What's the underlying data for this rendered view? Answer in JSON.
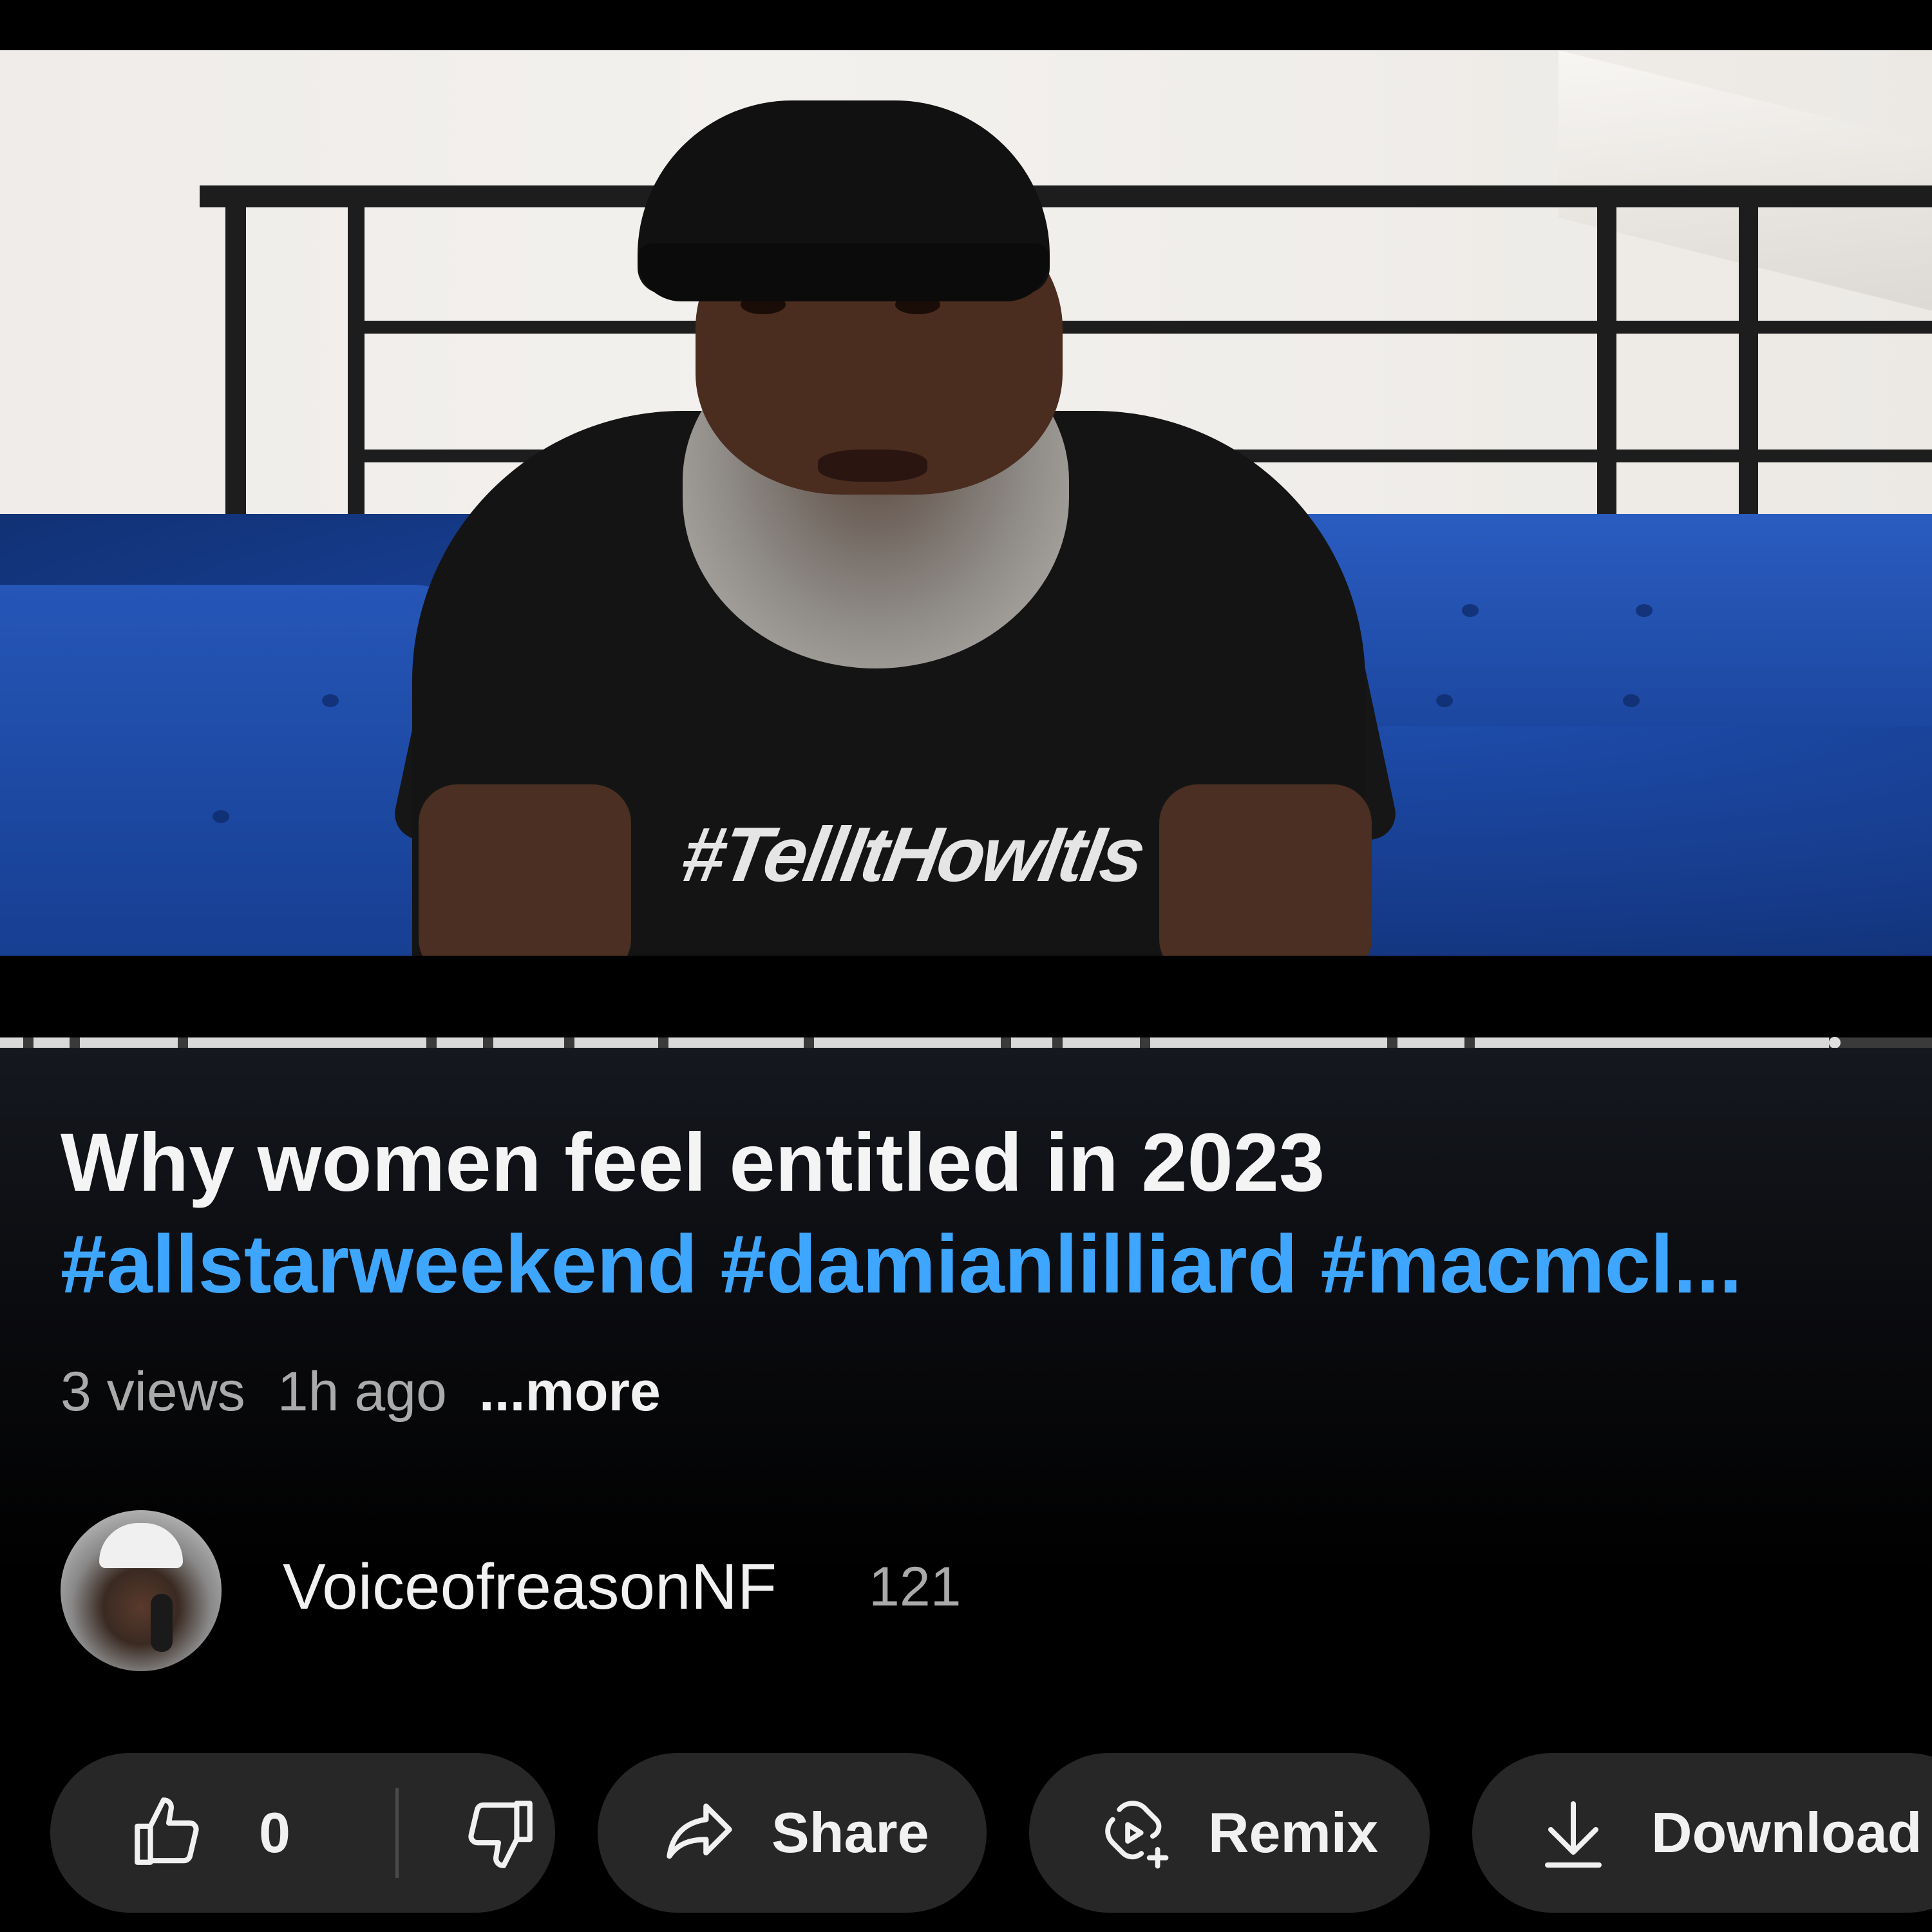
{
  "video": {
    "shirt_text": "#TellItHowItIs"
  },
  "title": "Why women feel entitled in 2023",
  "hashtags": "#allstarweekend #damianlilliard #macmcl...",
  "meta": {
    "views": "3 views",
    "age": "1h ago",
    "more": "...more"
  },
  "channel": {
    "name": "VoiceofreasonNF",
    "subscribers": "121"
  },
  "actions": {
    "like_count": "0",
    "share_label": "Share",
    "remix_label": "Remix",
    "download_label": "Download"
  },
  "colors": {
    "background": "#000000",
    "hashtag": "#3ea6ff",
    "pill": "#272727",
    "secondary_text": "#aaaaaa"
  },
  "icons": [
    "thumbs-up-icon",
    "thumbs-down-icon",
    "share-arrow-icon",
    "remix-icon",
    "download-icon"
  ]
}
